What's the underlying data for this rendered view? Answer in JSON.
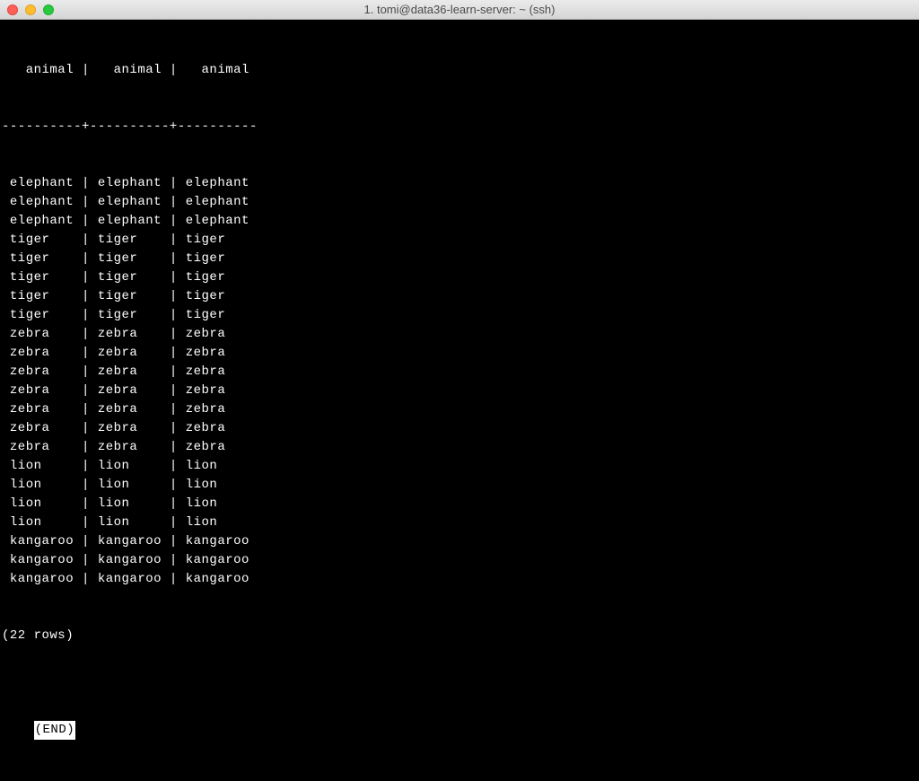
{
  "window": {
    "title": "1. tomi@data36-learn-server: ~ (ssh)"
  },
  "table": {
    "headers": [
      "animal",
      "animal",
      "animal"
    ],
    "separator": "----------+----------+----------",
    "rows": [
      [
        "elephant",
        "elephant",
        "elephant"
      ],
      [
        "elephant",
        "elephant",
        "elephant"
      ],
      [
        "elephant",
        "elephant",
        "elephant"
      ],
      [
        "tiger",
        "tiger",
        "tiger"
      ],
      [
        "tiger",
        "tiger",
        "tiger"
      ],
      [
        "tiger",
        "tiger",
        "tiger"
      ],
      [
        "tiger",
        "tiger",
        "tiger"
      ],
      [
        "tiger",
        "tiger",
        "tiger"
      ],
      [
        "zebra",
        "zebra",
        "zebra"
      ],
      [
        "zebra",
        "zebra",
        "zebra"
      ],
      [
        "zebra",
        "zebra",
        "zebra"
      ],
      [
        "zebra",
        "zebra",
        "zebra"
      ],
      [
        "zebra",
        "zebra",
        "zebra"
      ],
      [
        "zebra",
        "zebra",
        "zebra"
      ],
      [
        "zebra",
        "zebra",
        "zebra"
      ],
      [
        "lion",
        "lion",
        "lion"
      ],
      [
        "lion",
        "lion",
        "lion"
      ],
      [
        "lion",
        "lion",
        "lion"
      ],
      [
        "lion",
        "lion",
        "lion"
      ],
      [
        "kangaroo",
        "kangaroo",
        "kangaroo"
      ],
      [
        "kangaroo",
        "kangaroo",
        "kangaroo"
      ],
      [
        "kangaroo",
        "kangaroo",
        "kangaroo"
      ]
    ],
    "row_count_label": "(22 rows)"
  },
  "pager": {
    "end_marker": "(END)"
  }
}
